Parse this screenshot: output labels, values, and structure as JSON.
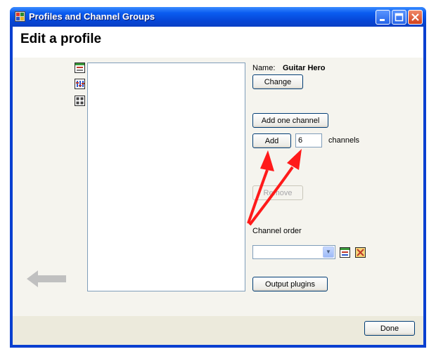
{
  "window": {
    "title": "Profiles and Channel Groups",
    "title_icon": "app-grid-icon",
    "controls": [
      "minimize-icon",
      "maximize-icon",
      "close-icon"
    ]
  },
  "page": {
    "heading": "Edit a profile"
  },
  "side_toolbar": [
    "profile-window-icon",
    "channel-mixer-icon",
    "grid-view-icon"
  ],
  "profile": {
    "name_label": "Name:",
    "name_value": "Guitar Hero",
    "change_label": "Change"
  },
  "channels": {
    "add_one_label": "Add one channel",
    "add_label": "Add",
    "count_value": "6",
    "count_suffix": "channels",
    "remove_label": "Remove"
  },
  "channel_order": {
    "label": "Channel order",
    "selected": "",
    "icons": [
      "edit-order-icon",
      "clear-order-icon"
    ]
  },
  "output_plugins_label": "Output plugins",
  "done_label": "Done",
  "colors": {
    "title_bar": "#0a5cf0",
    "dialog_background": "#f5f4ee",
    "annotation_arrow": "#ff1a1a",
    "back_arrow": "#c0c0c0"
  }
}
